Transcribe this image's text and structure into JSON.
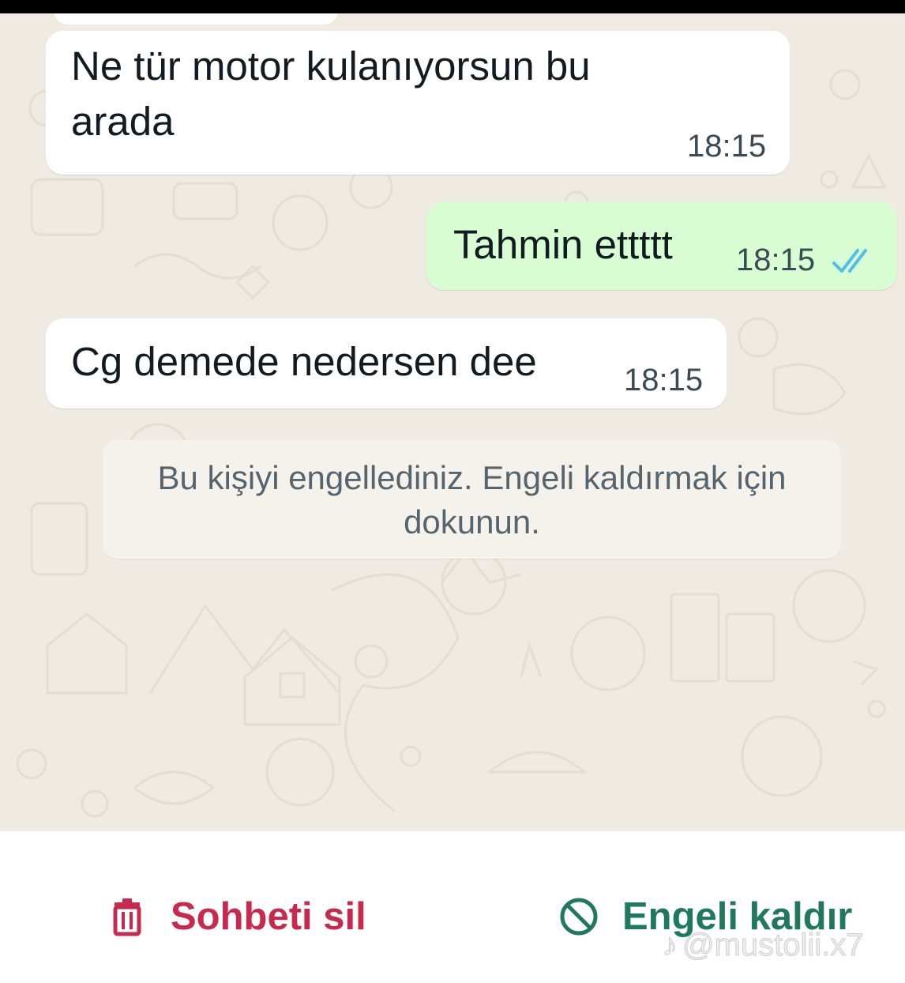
{
  "messages": [
    {
      "direction": "incoming",
      "text": "Ne tür motor kulanıyorsun bu\narada",
      "time": "18:15"
    },
    {
      "direction": "outgoing",
      "text": "Tahmin ettttt",
      "time": "18:15",
      "status": "read"
    },
    {
      "direction": "incoming",
      "text": "Cg demede nedersen dee",
      "time": "18:15"
    }
  ],
  "system_note": {
    "text": "Bu kişiyi engellediniz. Engeli kaldırmak için dokunun."
  },
  "actions": {
    "delete_label": "Sohbeti sil",
    "unblock_label": "Engeli kaldır"
  },
  "watermark": {
    "text": "@mustolii.x7",
    "icon": "tiktok-icon"
  },
  "colors": {
    "chat_background": "#efeae2",
    "incoming_bubble": "#ffffff",
    "outgoing_bubble": "#d9fdd3",
    "read_ticks": "#53bdeb",
    "delete_red": "#c8294c",
    "unblock_green": "#1f7a5c"
  }
}
